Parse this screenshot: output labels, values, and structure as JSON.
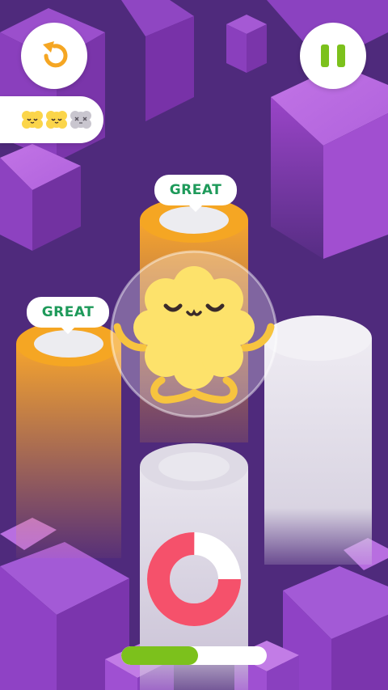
{
  "hud": {
    "restart_icon": "restart-arrow-icon",
    "pause_icon": "pause-icon",
    "lives": [
      {
        "state": "happy",
        "icon": "happy-face-icon"
      },
      {
        "state": "happy",
        "icon": "happy-face-icon"
      },
      {
        "state": "lost",
        "icon": "dead-face-icon"
      }
    ]
  },
  "ratings": {
    "center": "GREAT",
    "left": "GREAT"
  },
  "timer_ring": {
    "fraction_remaining": 0.25,
    "color": "#f5516b"
  },
  "level_progress": {
    "fraction": 0.53,
    "color": "#7cc11c"
  },
  "colors": {
    "background": "#4f2a7c",
    "cube": "#a24fd0",
    "pillar_orange": "#f5a623",
    "pillar_white": "#e9e6ef",
    "character": "#fde26b",
    "rating_text": "#1e9a5a"
  }
}
